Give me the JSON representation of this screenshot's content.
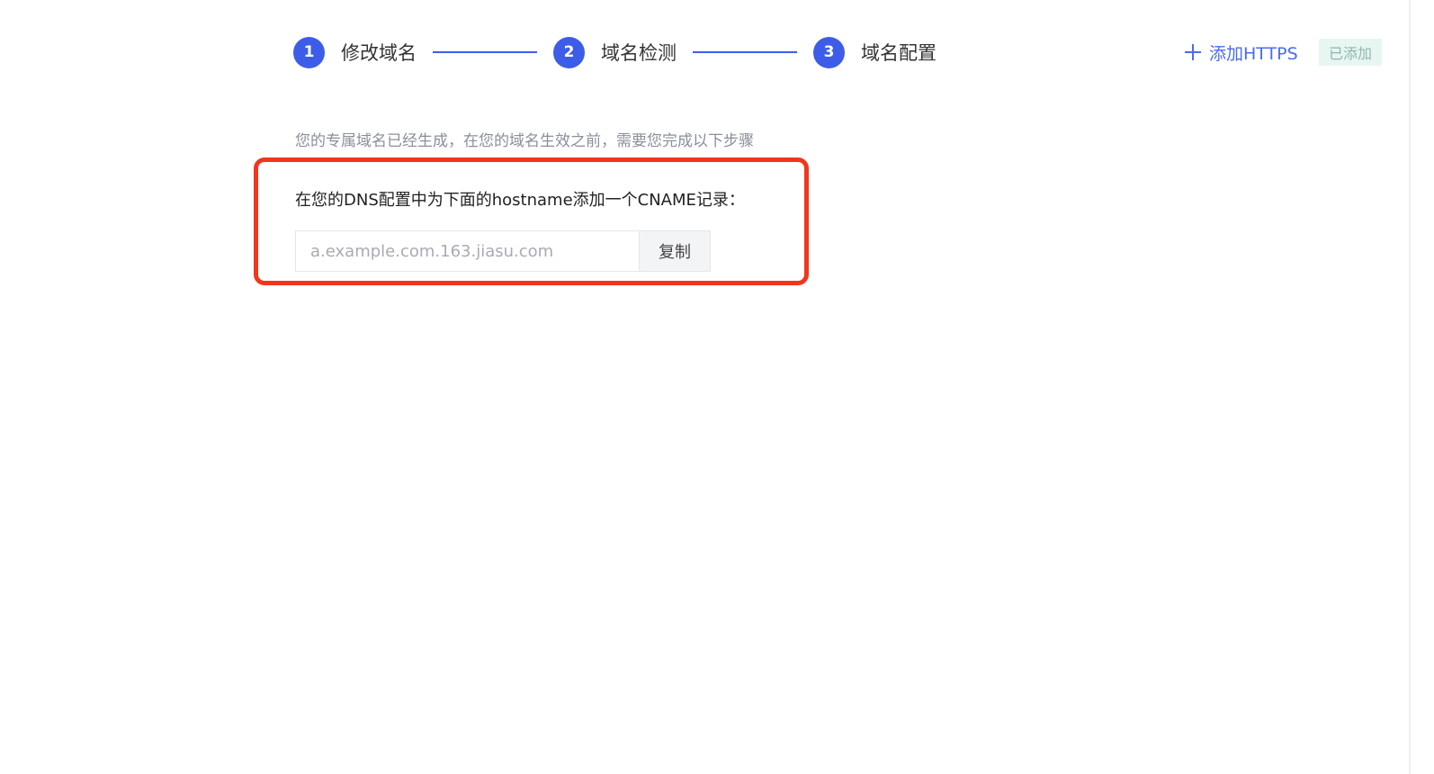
{
  "stepper": {
    "steps": [
      {
        "number": "1",
        "label": "修改域名"
      },
      {
        "number": "2",
        "label": "域名检测"
      },
      {
        "number": "3",
        "label": "域名配置"
      }
    ]
  },
  "header_actions": {
    "add_https_label": "添加HTTPS",
    "added_badge": "已添加"
  },
  "content": {
    "intro_text": "您的专属域名已经生成，在您的域名生效之前，需要您完成以下步骤",
    "instruction": "在您的DNS配置中为下面的hostname添加一个CNAME记录：",
    "hostname_placeholder": "a.example.com.163.jiasu.com",
    "hostname_value": "",
    "copy_label": "复制"
  },
  "colors": {
    "primary": "#3d5de8",
    "link": "#4a6cf0",
    "highlight_border": "#f2361c",
    "badge_bg": "#e7f6f2"
  }
}
